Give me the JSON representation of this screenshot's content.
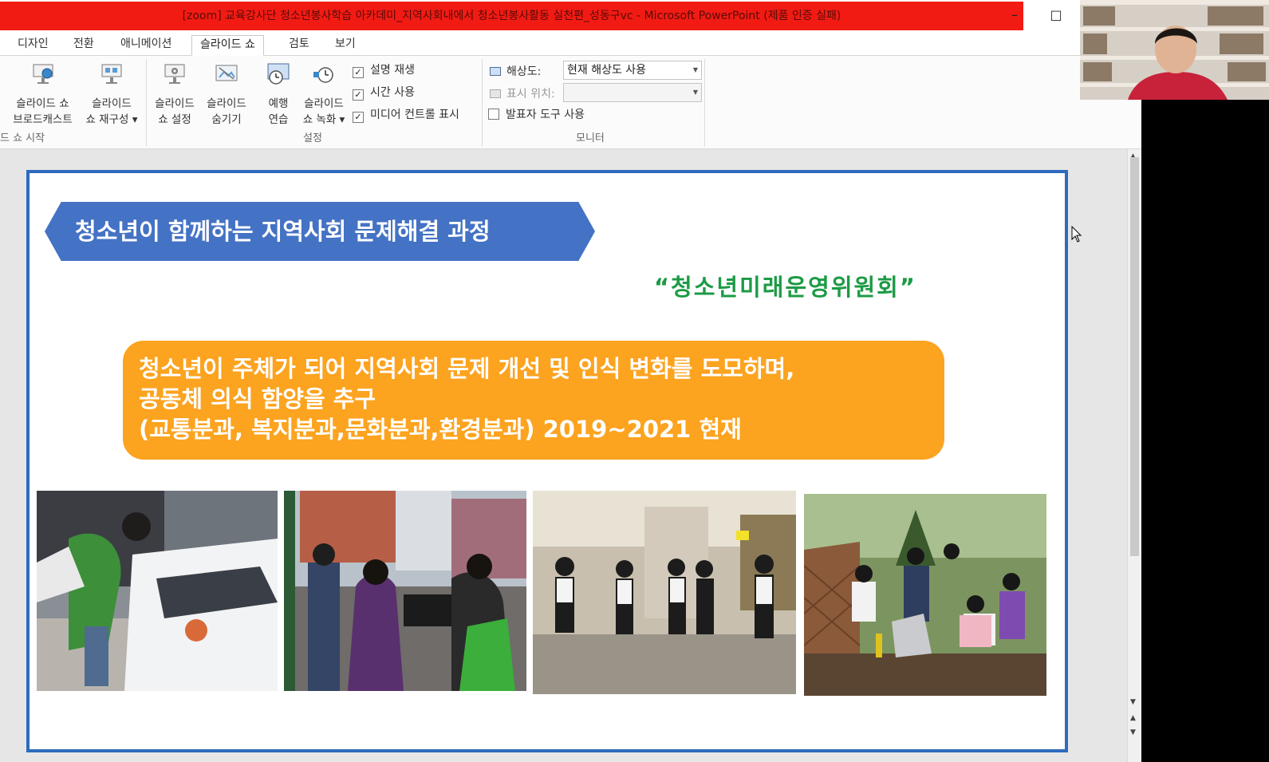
{
  "window": {
    "title": "[zoom] 교육강사단 청소년봉사학습 아카데미_지역사회내에서 청소년봉사활동 실천편_성동구vc  -  Microsoft PowerPoint (제품 인증 실패)",
    "minimize_glyph": "–",
    "maximize_glyph": "□"
  },
  "ribbon": {
    "tabs": [
      {
        "label": "디자인"
      },
      {
        "label": "전환"
      },
      {
        "label": "애니메이션"
      },
      {
        "label": "슬라이드 쇼",
        "active": true
      },
      {
        "label": "검토"
      },
      {
        "label": "보기"
      }
    ],
    "buttons": {
      "broadcast": {
        "line1": "슬라이드 쇼",
        "line2": "브로드캐스트"
      },
      "custom": {
        "line1": "슬라이드",
        "line2": "쇼 재구성 ▾"
      },
      "setup": {
        "line1": "슬라이드",
        "line2": "쇼 설정"
      },
      "hide": {
        "line1": "슬라이드",
        "line2": "숨기기"
      },
      "rehearse": {
        "line1": "예행",
        "line2": "연습"
      },
      "record": {
        "line1": "슬라이드",
        "line2": "쇼 녹화 ▾"
      }
    },
    "checkboxes": [
      {
        "label": "설명 재생",
        "checked": true
      },
      {
        "label": "시간 사용",
        "checked": true
      },
      {
        "label": "미디어 컨트롤 표시",
        "checked": true
      },
      {
        "label": "발표자 도구 사용",
        "checked": false
      }
    ],
    "monitor": {
      "resolution_label": "해상도:",
      "resolution_value": "현재 해상도 사용",
      "show_on_label": "표시 위치:",
      "show_on_value": ""
    },
    "groups": {
      "start": "드 쇼 시작",
      "setup": "설정",
      "monitor": "모니터"
    }
  },
  "slide": {
    "banner_title": "청소년이  함께하는 지역사회 문제해결 과정",
    "quote": "“청소년미래운영위원회”",
    "box_lines": [
      "청소년이 주체가 되어 지역사회 문제 개선 및 인식 변화를 도모하며,",
      "공동체 의식 함양을 추구",
      "(교통분과, 복지분과,문화분과,환경분과) 2019~2021 현재"
    ]
  },
  "colors": {
    "title_bar": "#f11b14",
    "banner": "#4472c4",
    "quote": "#1c9b45",
    "box": "#fca31f",
    "slide_border": "#2d6bbd"
  }
}
